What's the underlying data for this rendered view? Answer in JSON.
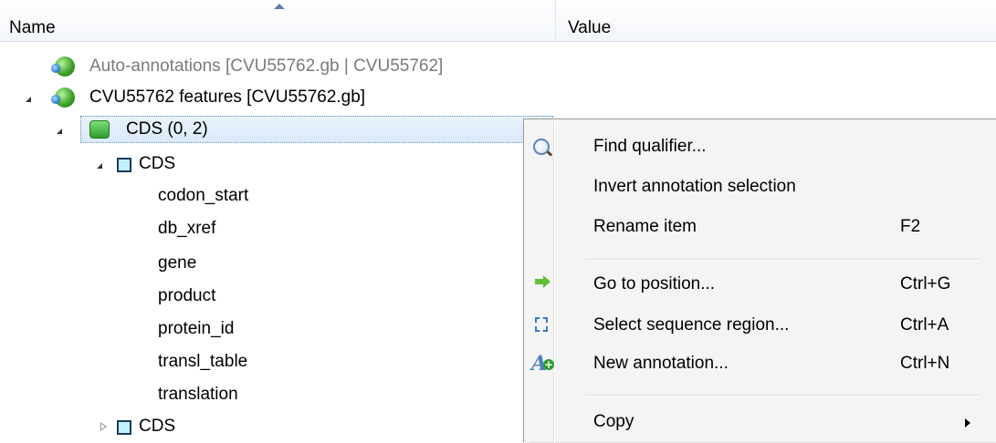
{
  "header": {
    "name_label": "Name",
    "value_label": "Value"
  },
  "tree": {
    "auto_annotations": "Auto-annotations [CVU55762.gb | CVU55762]",
    "features": "CVU55762 features [CVU55762.gb]",
    "cds_group": "CDS  (0, 2)",
    "cds_item": "CDS",
    "qualifiers": [
      "codon_start",
      "db_xref",
      "gene",
      "product",
      "protein_id",
      "transl_table",
      "translation"
    ],
    "cds_item2": "CDS"
  },
  "context_menu": {
    "items": [
      {
        "label": "Find qualifier...",
        "shortcut": "",
        "icon": "magnifier-icon"
      },
      {
        "label": "Invert annotation selection",
        "shortcut": "",
        "icon": ""
      },
      {
        "label": "Rename item",
        "shortcut": "F2",
        "icon": ""
      },
      {
        "label": "Go to position...",
        "shortcut": "Ctrl+G",
        "icon": "green-arrow-icon"
      },
      {
        "label": "Select sequence region...",
        "shortcut": "Ctrl+A",
        "icon": "select-region-icon"
      },
      {
        "label": "New annotation...",
        "shortcut": "Ctrl+N",
        "icon": "new-annotation-icon"
      },
      {
        "label": "Copy",
        "shortcut": "",
        "icon": ""
      }
    ]
  },
  "colors": {
    "selection": "#d9e9fb",
    "menu_bg": "#f4f4f4",
    "muted_text": "#7a7a7a"
  }
}
